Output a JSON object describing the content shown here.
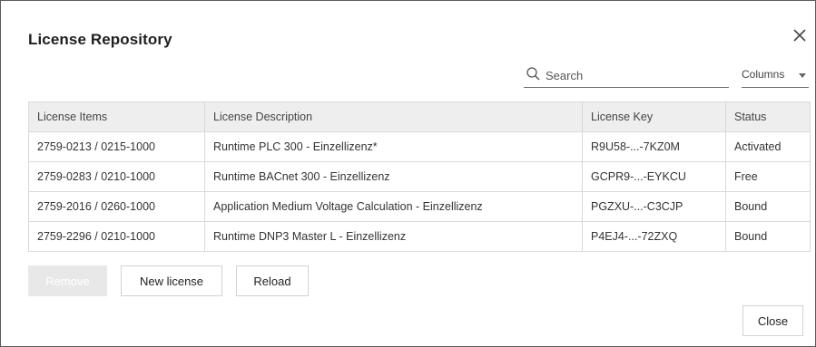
{
  "dialog": {
    "title": "License Repository",
    "close_icon": "close-icon"
  },
  "toolbar": {
    "search_placeholder": "Search",
    "search_value": "",
    "columns_label": "Columns"
  },
  "table": {
    "headers": [
      "License Items",
      "License Description",
      "License Key",
      "Status"
    ],
    "rows": [
      [
        "2759-0213 / 0215-1000",
        "Runtime PLC 300 - Einzellizenz*",
        "R9U58-...-7KZ0M",
        "Activated"
      ],
      [
        "2759-0283 / 0210-1000",
        "Runtime BACnet 300 - Einzellizenz",
        "GCPR9-...-EYKCU",
        "Free"
      ],
      [
        "2759-2016 / 0260-1000",
        "Application Medium Voltage Calculation - Einzellizenz",
        "PGZXU-...-C3CJP",
        "Bound"
      ],
      [
        "2759-2296 / 0210-1000",
        "Runtime DNP3 Master L - Einzellizenz",
        "P4EJ4-...-72ZXQ",
        "Bound"
      ]
    ]
  },
  "actions": {
    "remove_label": "Remove",
    "new_license_label": "New license",
    "reload_label": "Reload",
    "close_label": "Close"
  },
  "colors": {
    "header_bg": "#eeeeee",
    "border": "#d9d9d9",
    "disabled_button_bg": "#e8e8e8"
  }
}
